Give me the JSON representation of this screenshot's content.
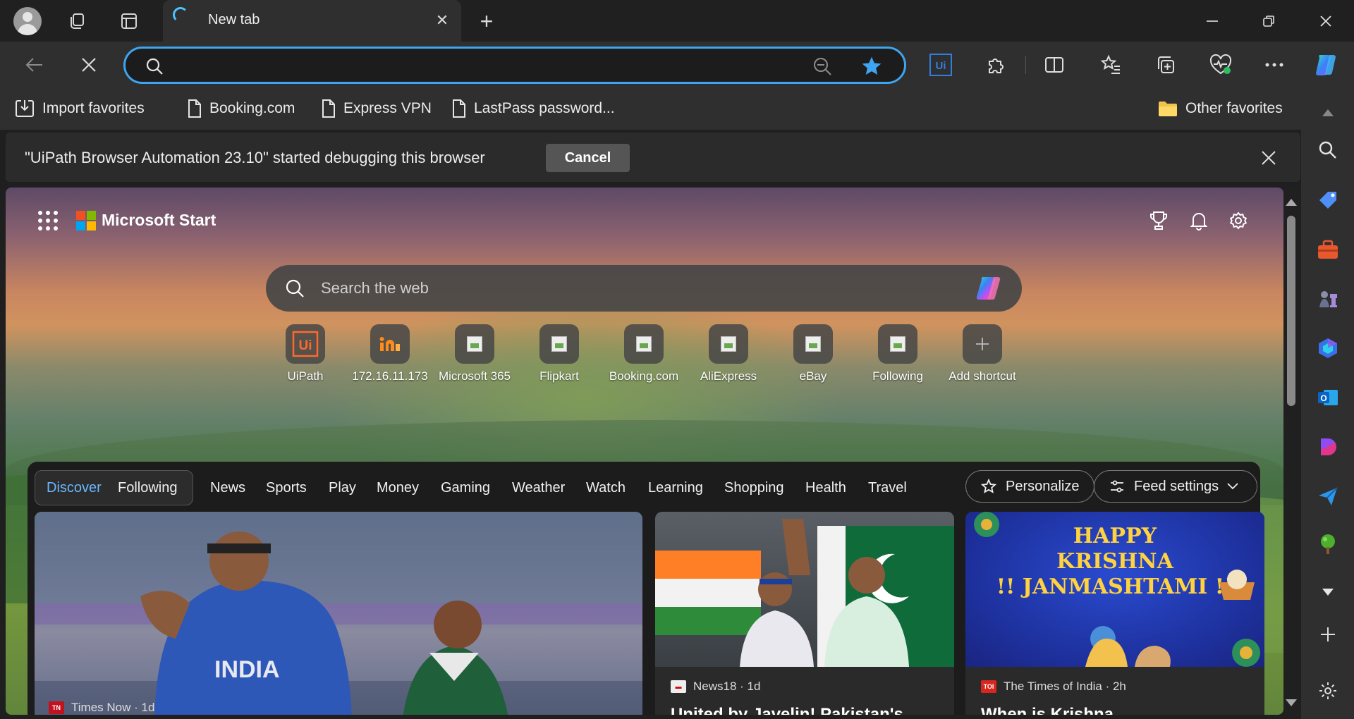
{
  "tab": {
    "title": "New tab",
    "close": "✕",
    "new_tab": "+"
  },
  "window": {
    "minimize": "—",
    "restore": "❐",
    "close": "✕"
  },
  "address": {
    "value": "",
    "placeholder": ""
  },
  "favorites": [
    {
      "label": "Import favorites",
      "icon": "import-icon"
    },
    {
      "label": "Booking.com",
      "icon": "page-icon"
    },
    {
      "label": "Express VPN",
      "icon": "page-icon"
    },
    {
      "label": "LastPass password...",
      "icon": "page-icon"
    }
  ],
  "other_favorites": "Other favorites",
  "infobar": {
    "message": "\"UiPath Browser Automation 23.10\" started debugging this browser",
    "cancel": "Cancel"
  },
  "start": {
    "brand": "Microsoft Start",
    "search_placeholder": "Search the web",
    "shortcuts": [
      {
        "label": "UiPath"
      },
      {
        "label": "172.16.11.173"
      },
      {
        "label": "Microsoft 365"
      },
      {
        "label": "Flipkart"
      },
      {
        "label": "Booking.com"
      },
      {
        "label": "AliExpress"
      },
      {
        "label": "eBay"
      },
      {
        "label": "Following"
      },
      {
        "label": "Add shortcut"
      }
    ]
  },
  "feed": {
    "tabs": [
      "Discover",
      "Following",
      "News",
      "Sports",
      "Play",
      "Money",
      "Gaming",
      "Weather",
      "Watch",
      "Learning",
      "Shopping",
      "Health",
      "Travel"
    ],
    "personalize": "Personalize",
    "feed_settings": "Feed settings",
    "cards": [
      {
        "source": "Times Now · 1d",
        "headline": ""
      },
      {
        "source": "News18 · 1d",
        "headline": "United by Javelin! Pakistan's"
      },
      {
        "source": "The Times of India · 2h",
        "headline": "When is Krishna"
      }
    ],
    "banner_text": [
      "HAPPY",
      "KRISHNA",
      "!! JANMASHTAMI !!"
    ],
    "jersey_text": "INDIA"
  },
  "colors": {
    "accent": "#3fa5f0",
    "active_tab_text": "#6ab7ff"
  }
}
